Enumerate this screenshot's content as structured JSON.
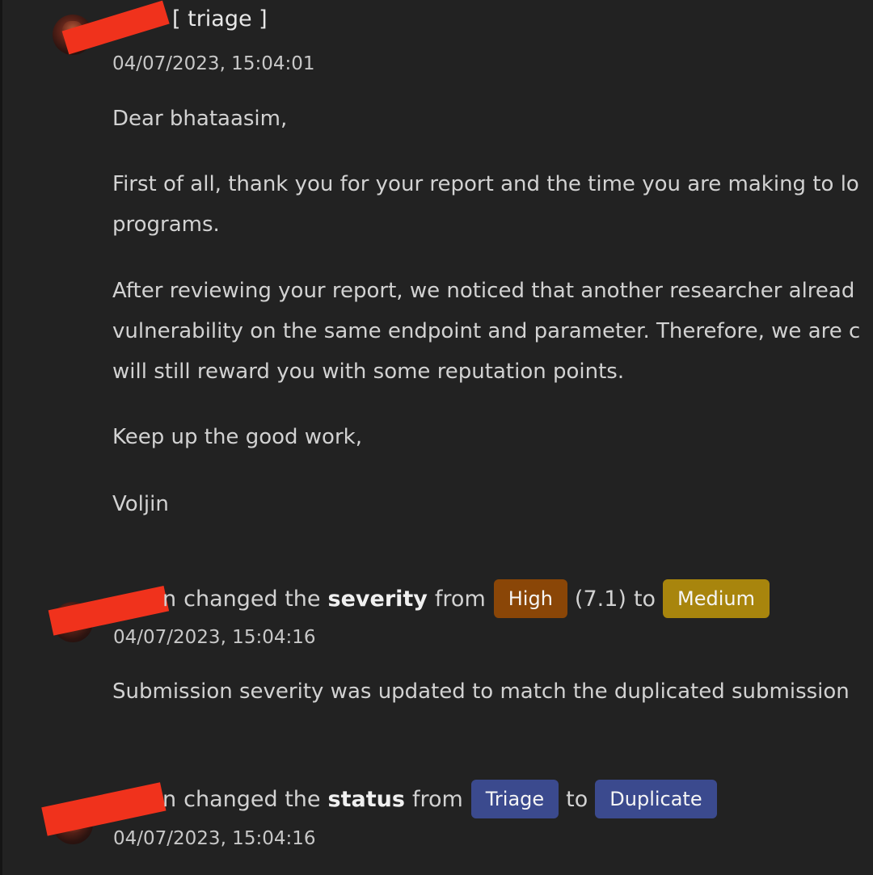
{
  "comment": {
    "author_tail": "[ triage ]",
    "timestamp": "04/07/2023, 15:04:01",
    "body": [
      "Dear bhataasim,",
      "First of all, thank you for your report and the time you are making to lo",
      "programs.",
      "After reviewing your report, we noticed that another researcher alread",
      "vulnerability on the same endpoint and parameter. Therefore, we are c",
      "will still reward you with some reputation points.",
      "Keep up the good work,",
      "Voljin"
    ]
  },
  "severity_event": {
    "author_tail": "n",
    "action": "changed the",
    "field": "severity",
    "from_word": "from",
    "from_value": "High",
    "score": "(7.1)",
    "to_word": "to",
    "to_value": "Medium",
    "timestamp": "04/07/2023, 15:04:16",
    "note": "Submission severity was updated to match the duplicated submission"
  },
  "status_event": {
    "author_tail": "n",
    "action": "changed the",
    "field": "status",
    "from_word": "from",
    "from_value": "Triage",
    "to_word": "to",
    "to_value": "Duplicate",
    "timestamp": "04/07/2023, 15:04:16"
  },
  "colors": {
    "background": "#222222",
    "redaction": "#f0321c",
    "high": "#8a4607",
    "medium": "#a8850d",
    "status": "#3b4a8e"
  }
}
